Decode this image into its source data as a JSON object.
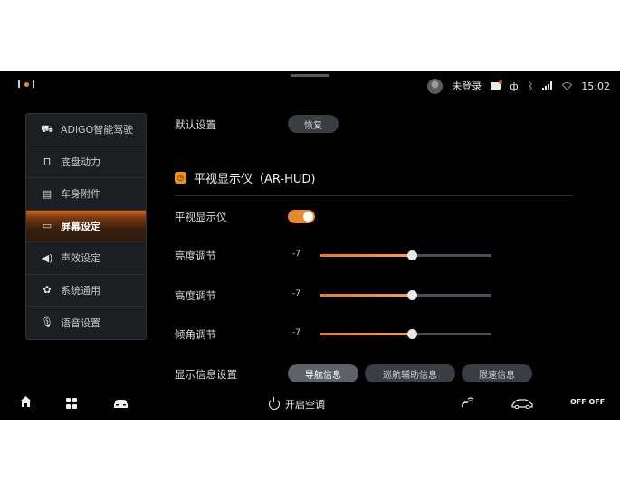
{
  "status_bar": {
    "user": "未登录",
    "time": "15:02",
    "icons": [
      "message-icon",
      "phone-icon",
      "bluetooth-icon",
      "signal-icon",
      "wifi-icon"
    ]
  },
  "sidebar": {
    "items": [
      {
        "label": "ADiGO智能驾驶",
        "icon": "steering-wheel-icon"
      },
      {
        "label": "底盘动力",
        "icon": "chassis-icon"
      },
      {
        "label": "车身附件",
        "icon": "car-body-icon"
      },
      {
        "label": "屏幕设定",
        "icon": "monitor-icon",
        "active": true
      },
      {
        "label": "声效设定",
        "icon": "speaker-icon"
      },
      {
        "label": "系统通用",
        "icon": "gear-icon"
      },
      {
        "label": "语音设置",
        "icon": "microphone-icon"
      }
    ]
  },
  "content": {
    "default_settings": {
      "label": "默认设置",
      "button": "恢复"
    },
    "section_title": "平视显示仪（AR-HUD)",
    "hud_toggle": {
      "label": "平视显示仪",
      "on": true
    },
    "sliders": [
      {
        "label": "亮度调节",
        "value": "-7",
        "fraction": 0.54
      },
      {
        "label": "高度调节",
        "value": "-7",
        "fraction": 0.54
      },
      {
        "label": "倾角调节",
        "value": "-7",
        "fraction": 0.54
      }
    ],
    "display_info": {
      "label": "显示信息设置",
      "options": [
        "导航信息",
        "巡航辅助信息",
        "限速信息"
      ],
      "selected": "导航信息"
    }
  },
  "bottom_bar": {
    "ac_label": "开启空调",
    "off_label": "OFF OFF"
  },
  "colors": {
    "accent": "#e68a2e",
    "background": "#000000",
    "panel": "#1c1e22"
  }
}
